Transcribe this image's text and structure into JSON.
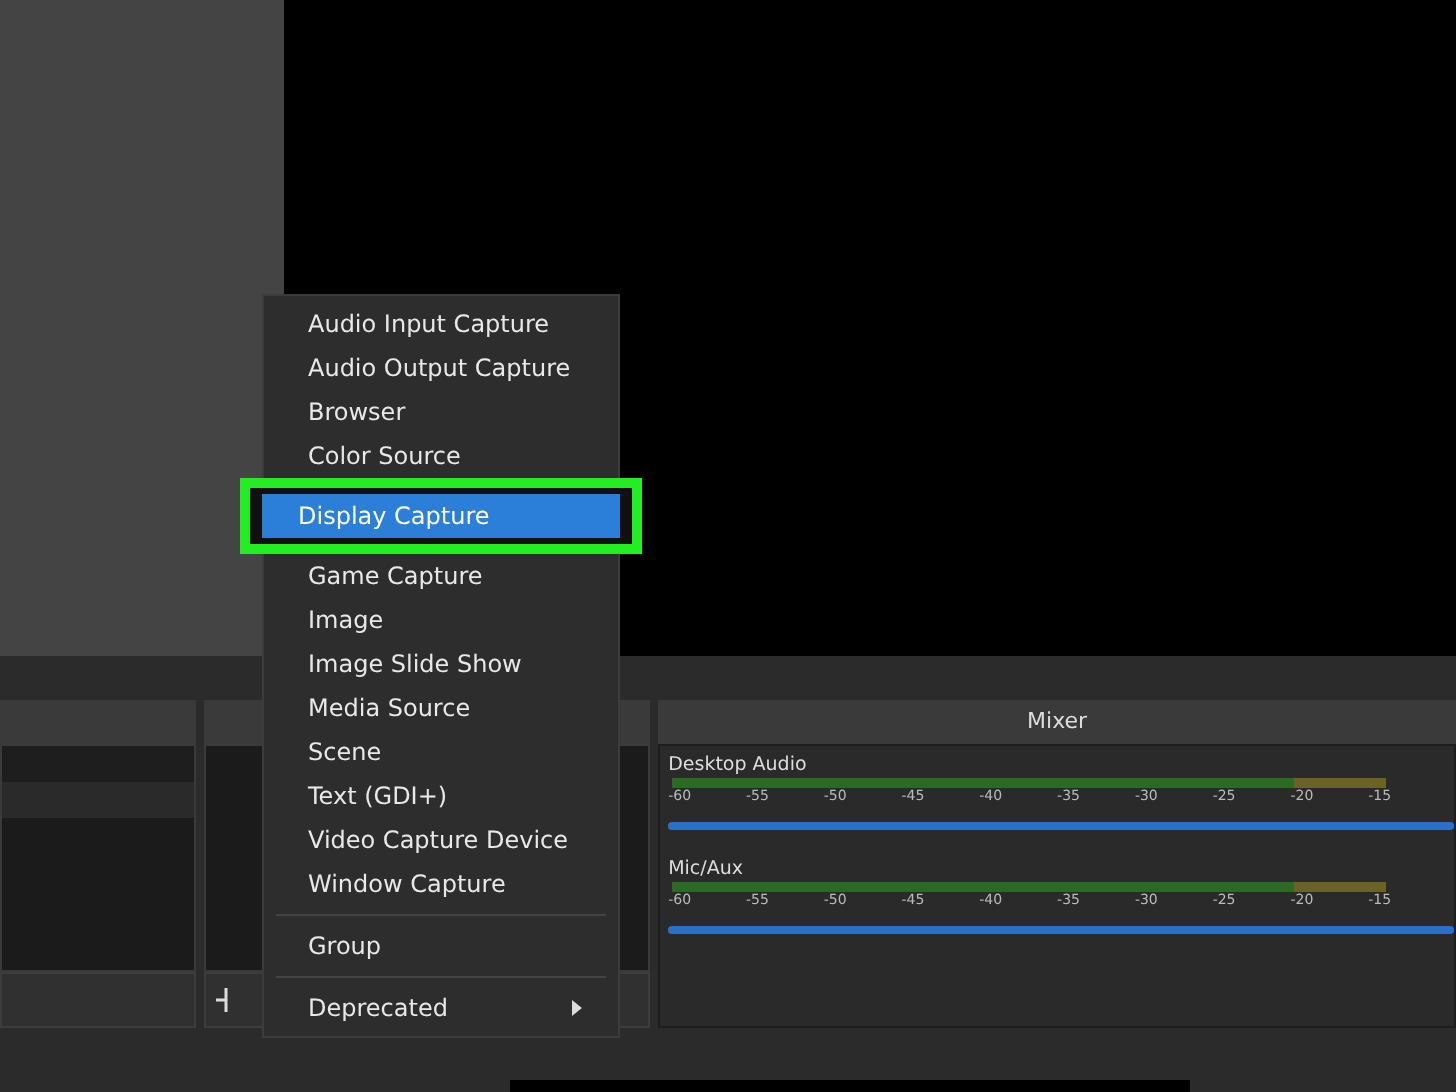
{
  "source_menu": {
    "items": [
      {
        "kind": "item",
        "label": "Audio Input Capture",
        "selected": false
      },
      {
        "kind": "item",
        "label": "Audio Output Capture",
        "selected": false
      },
      {
        "kind": "item",
        "label": "Browser",
        "selected": false
      },
      {
        "kind": "item",
        "label": "Color Source",
        "selected": false
      },
      {
        "kind": "item",
        "label": "Display Capture",
        "selected": true
      },
      {
        "kind": "item",
        "label": "Game Capture",
        "selected": false
      },
      {
        "kind": "item",
        "label": "Image",
        "selected": false
      },
      {
        "kind": "item",
        "label": "Image Slide Show",
        "selected": false
      },
      {
        "kind": "item",
        "label": "Media Source",
        "selected": false
      },
      {
        "kind": "item",
        "label": "Scene",
        "selected": false
      },
      {
        "kind": "item",
        "label": "Text (GDI+)",
        "selected": false
      },
      {
        "kind": "item",
        "label": "Video Capture Device",
        "selected": false
      },
      {
        "kind": "item",
        "label": "Window Capture",
        "selected": false
      },
      {
        "kind": "separator"
      },
      {
        "kind": "item",
        "label": "Group",
        "selected": false
      },
      {
        "kind": "separator"
      },
      {
        "kind": "submenu",
        "label": "Deprecated",
        "selected": false
      }
    ]
  },
  "mixer": {
    "title": "Mixer",
    "channels": [
      {
        "name": "Desktop Audio",
        "ticks": [
          "-60",
          "-55",
          "-50",
          "-45",
          "-40",
          "-35",
          "-30",
          "-25",
          "-20",
          "-15"
        ],
        "level": 1
      },
      {
        "name": "Mic/Aux",
        "ticks": [
          "-60",
          "-55",
          "-50",
          "-45",
          "-40",
          "-35",
          "-30",
          "-25",
          "-20",
          "-15"
        ],
        "level": 1
      }
    ]
  }
}
